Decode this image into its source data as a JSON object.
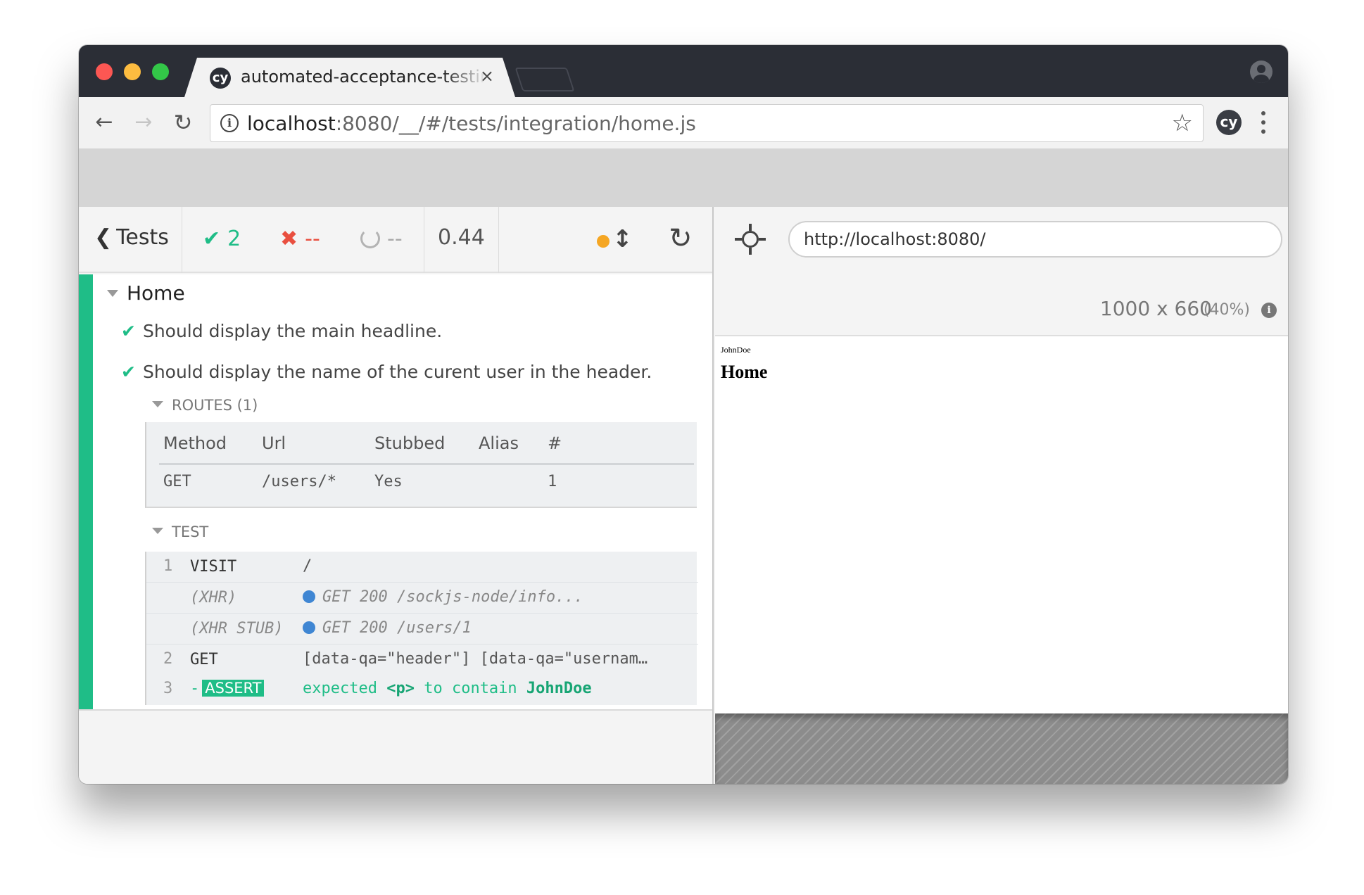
{
  "browser": {
    "tab_title": "automated-acceptance-testing",
    "tab_favicon": "cy",
    "tab_close": "×",
    "url_host": "localhost",
    "url_path": ":8080/__/#/tests/integration/home.js",
    "extension_label": "cy"
  },
  "reporter": {
    "tests_link": "Tests",
    "passed_count": "2",
    "failed_count": "--",
    "pending_count": "--",
    "duration": "0.44",
    "suite": {
      "title": "Home",
      "tests": [
        {
          "title": "Should display the main headline.",
          "state": "passed"
        },
        {
          "title": "Should display the name of the curent user in the header.",
          "state": "passed"
        }
      ]
    },
    "routes": {
      "title": "ROUTES (1)",
      "columns": [
        "Method",
        "Url",
        "Stubbed",
        "Alias",
        "#"
      ],
      "rows": [
        {
          "method": "GET",
          "url": "/users/*",
          "stubbed": "Yes",
          "alias": "",
          "count": "1"
        }
      ]
    },
    "test_section_title": "TEST",
    "commands": [
      {
        "num": "1",
        "name": "VISIT",
        "message": "/"
      },
      {
        "num": "",
        "name": "(XHR)",
        "message": "GET 200 /sockjs-node/info..."
      },
      {
        "num": "",
        "name": "(XHR STUB)",
        "message": "GET 200 /users/1"
      },
      {
        "num": "2",
        "name": "GET",
        "message": "[data-qa=\"header\"] [data-qa=\"usernam…"
      },
      {
        "num": "3",
        "name": "ASSERT",
        "expected": "expected",
        "subject": "<p>",
        "verb": "to contain",
        "value": "JohnDoe"
      }
    ]
  },
  "aut": {
    "url": "http://localhost:8080/",
    "viewport": "1000 x 660",
    "scale": "(40%)",
    "page_user": "JohnDoe",
    "page_heading": "Home"
  },
  "colors": {
    "passed": "#1fbd87",
    "failed": "#e94f3f",
    "running": "#f5a623",
    "xhr": "#3f86d3"
  }
}
